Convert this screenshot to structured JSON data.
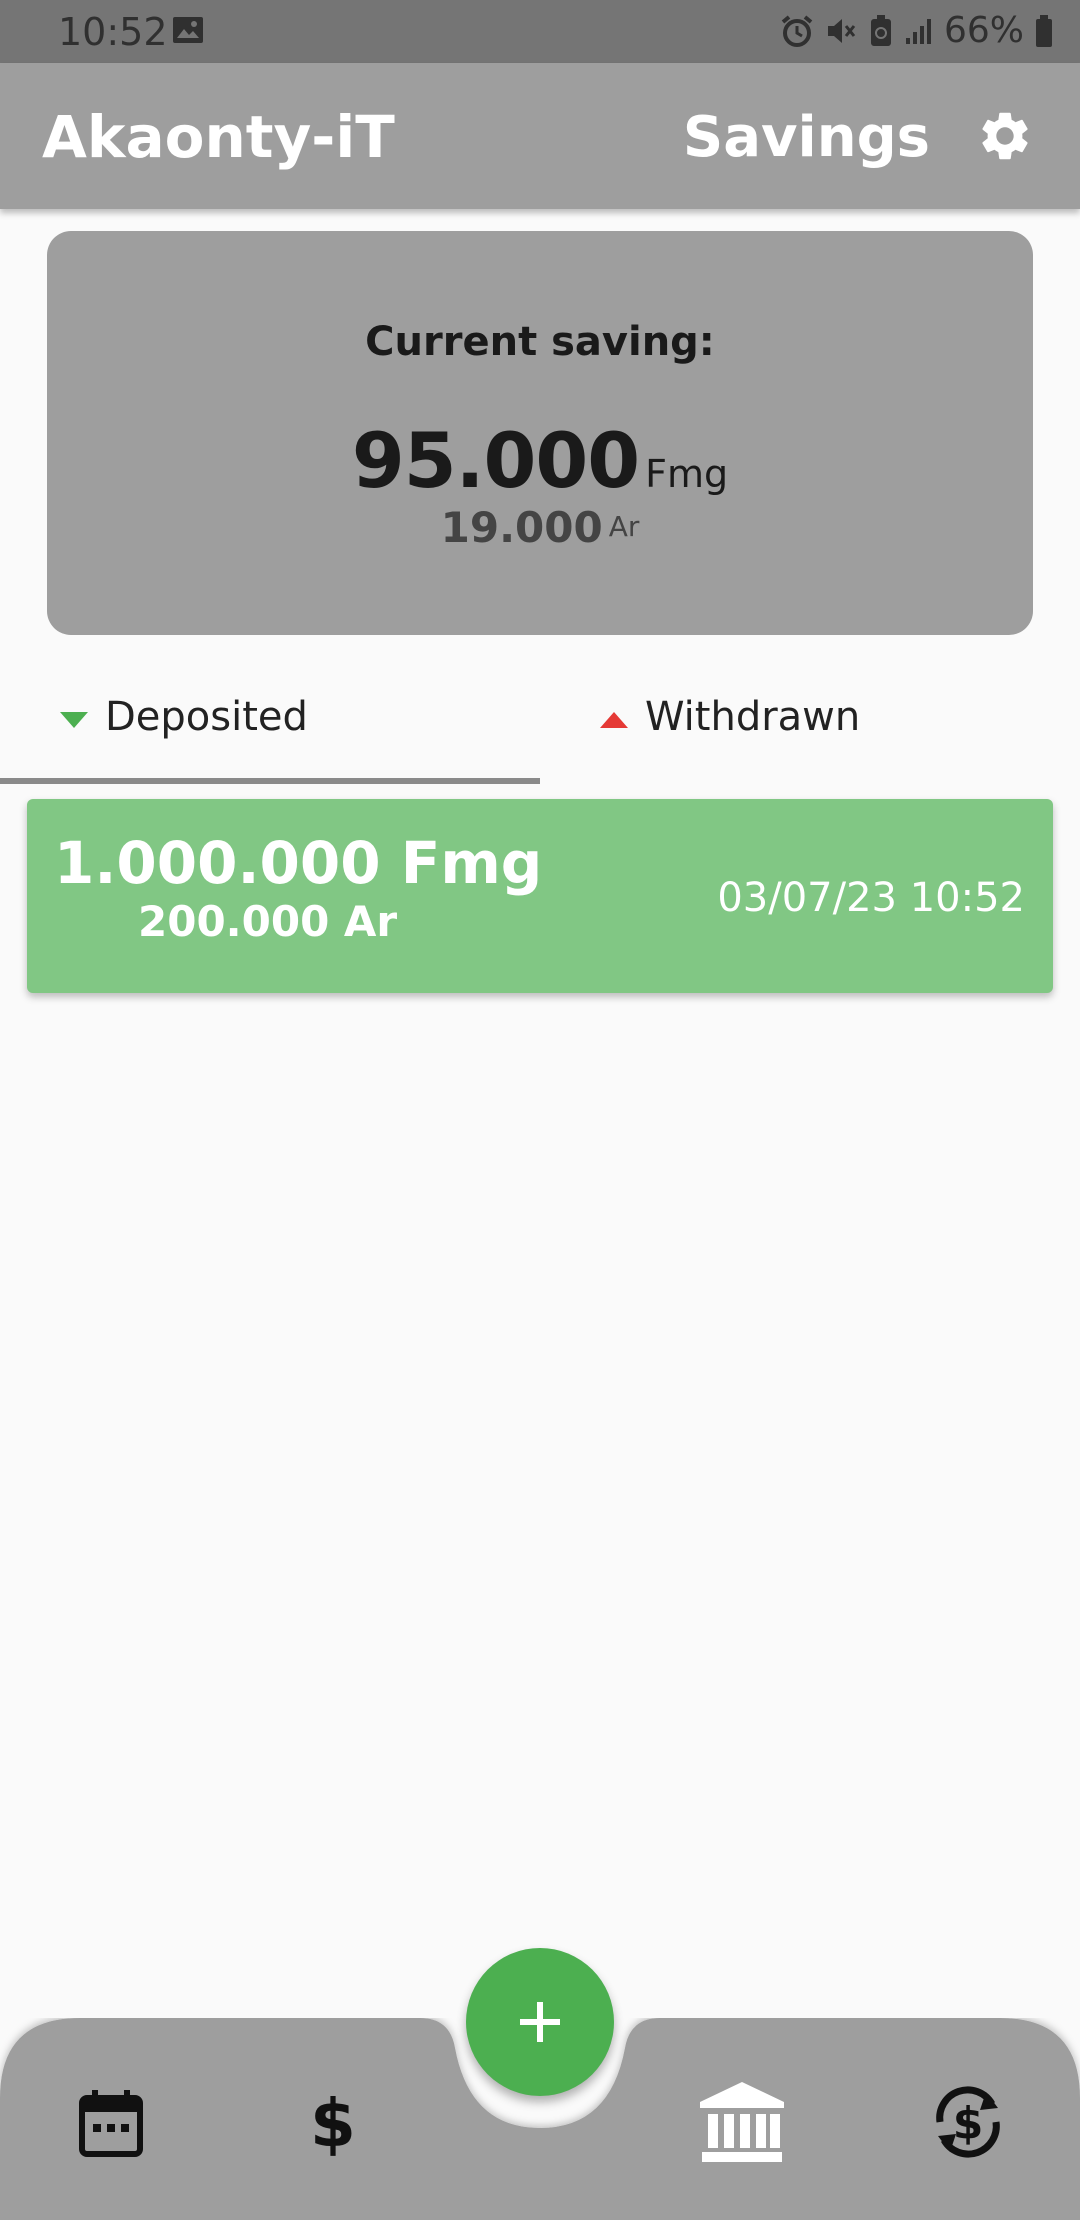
{
  "status_bar": {
    "time": "10:52",
    "battery": "66%"
  },
  "app_bar": {
    "title": "Akaonty-iT",
    "section": "Savings"
  },
  "summary": {
    "label": "Current saving:",
    "amount": "95.000",
    "unit": "Fmg",
    "sub_amount": "19.000",
    "sub_unit": "Ar"
  },
  "tabs": [
    {
      "label": "Deposited",
      "selected": true,
      "color": "#4caf50"
    },
    {
      "label": "Withdrawn",
      "selected": false,
      "color": "#e53935"
    }
  ],
  "transactions": [
    {
      "amount": "1.000.000 Fmg",
      "sub_amount": "200.000 Ar",
      "date": "03/07/23 10:52"
    }
  ],
  "bottom_nav": [
    {
      "icon": "calendar-icon"
    },
    {
      "icon": "dollar-icon"
    },
    {
      "icon": "bank-icon"
    },
    {
      "icon": "currency-exchange-icon"
    }
  ],
  "fab": {
    "icon": "plus-icon"
  },
  "colors": {
    "accent": "#4caf50",
    "deposit_row": "#81c784",
    "appbar": "#9e9e9e"
  }
}
